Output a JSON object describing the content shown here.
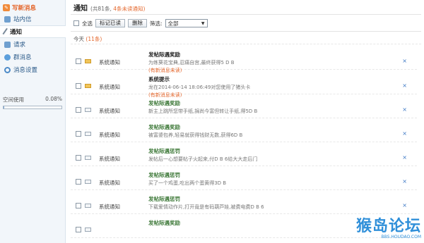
{
  "sidebar": {
    "compose_label": "写新消息",
    "items": [
      {
        "label": "站内信"
      },
      {
        "label": "通知"
      },
      {
        "label": "请求"
      },
      {
        "label": "群消息"
      },
      {
        "label": "消息设置"
      }
    ],
    "space_label": "空间使用",
    "space_value": "0.08%",
    "space_fraction": 0.0008
  },
  "header": {
    "title": "通知",
    "total": "(共81条,",
    "unread": "4条未读通知)"
  },
  "toolbar": {
    "select_all_label": "全选",
    "mark_read_label": "标记已读",
    "delete_label": "删除",
    "filter_label": "筛选:",
    "filter_value": "全部"
  },
  "today": {
    "label": "今天",
    "count": "(11条)"
  },
  "rows": [
    {
      "type": "系统通知",
      "subject": "发帖际遇奖励",
      "desc": "为练葵花宝典,忍痛自宫,最终获得5 D B",
      "flag": "(有新消息未读)",
      "unread": true
    },
    {
      "type": "系统通知",
      "subject": "系统提示",
      "desc": "龙在2014-06-14 18:06:49对您使用了猪头卡",
      "flag": "(有新消息未读)",
      "unread": true
    },
    {
      "type": "系统通知",
      "subject": "发帖际遇奖励",
      "desc": "新主上跳所您带手纸,捐尚今富但转让手纸,得5D B",
      "flag": "",
      "unread": false
    },
    {
      "type": "系统通知",
      "subject": "发帖际遇奖励",
      "desc": "被富婆包养,轻易就获得钱财无数,获得6D B",
      "flag": "",
      "unread": false
    },
    {
      "type": "系统通知",
      "subject": "发帖际遇惩罚",
      "desc": "发帖后一心想要帖子火起来,付D B 6给大大走后门",
      "flag": "",
      "unread": false
    },
    {
      "type": "系统通知",
      "subject": "发帖际遇惩罚",
      "desc": "买了一个鸡蛋,吃出两个蛋黄得3D B",
      "flag": "",
      "unread": false
    },
    {
      "type": "系统通知",
      "subject": "发帖际遇惩罚",
      "desc": "下载爱情动作片,打开竟是有码葫芦娃,被费电费D B 6",
      "flag": "",
      "unread": false
    },
    {
      "type": "",
      "subject": "发帖际遇奖励",
      "desc": "",
      "flag": "",
      "unread": false
    }
  ],
  "watermark": {
    "big": "猴岛论坛",
    "small": "BBS.HOUDAO.COM"
  },
  "colors": {
    "accent": "#e4662b",
    "link": "#3d78c4",
    "green_subject": "#3f7a3a"
  }
}
